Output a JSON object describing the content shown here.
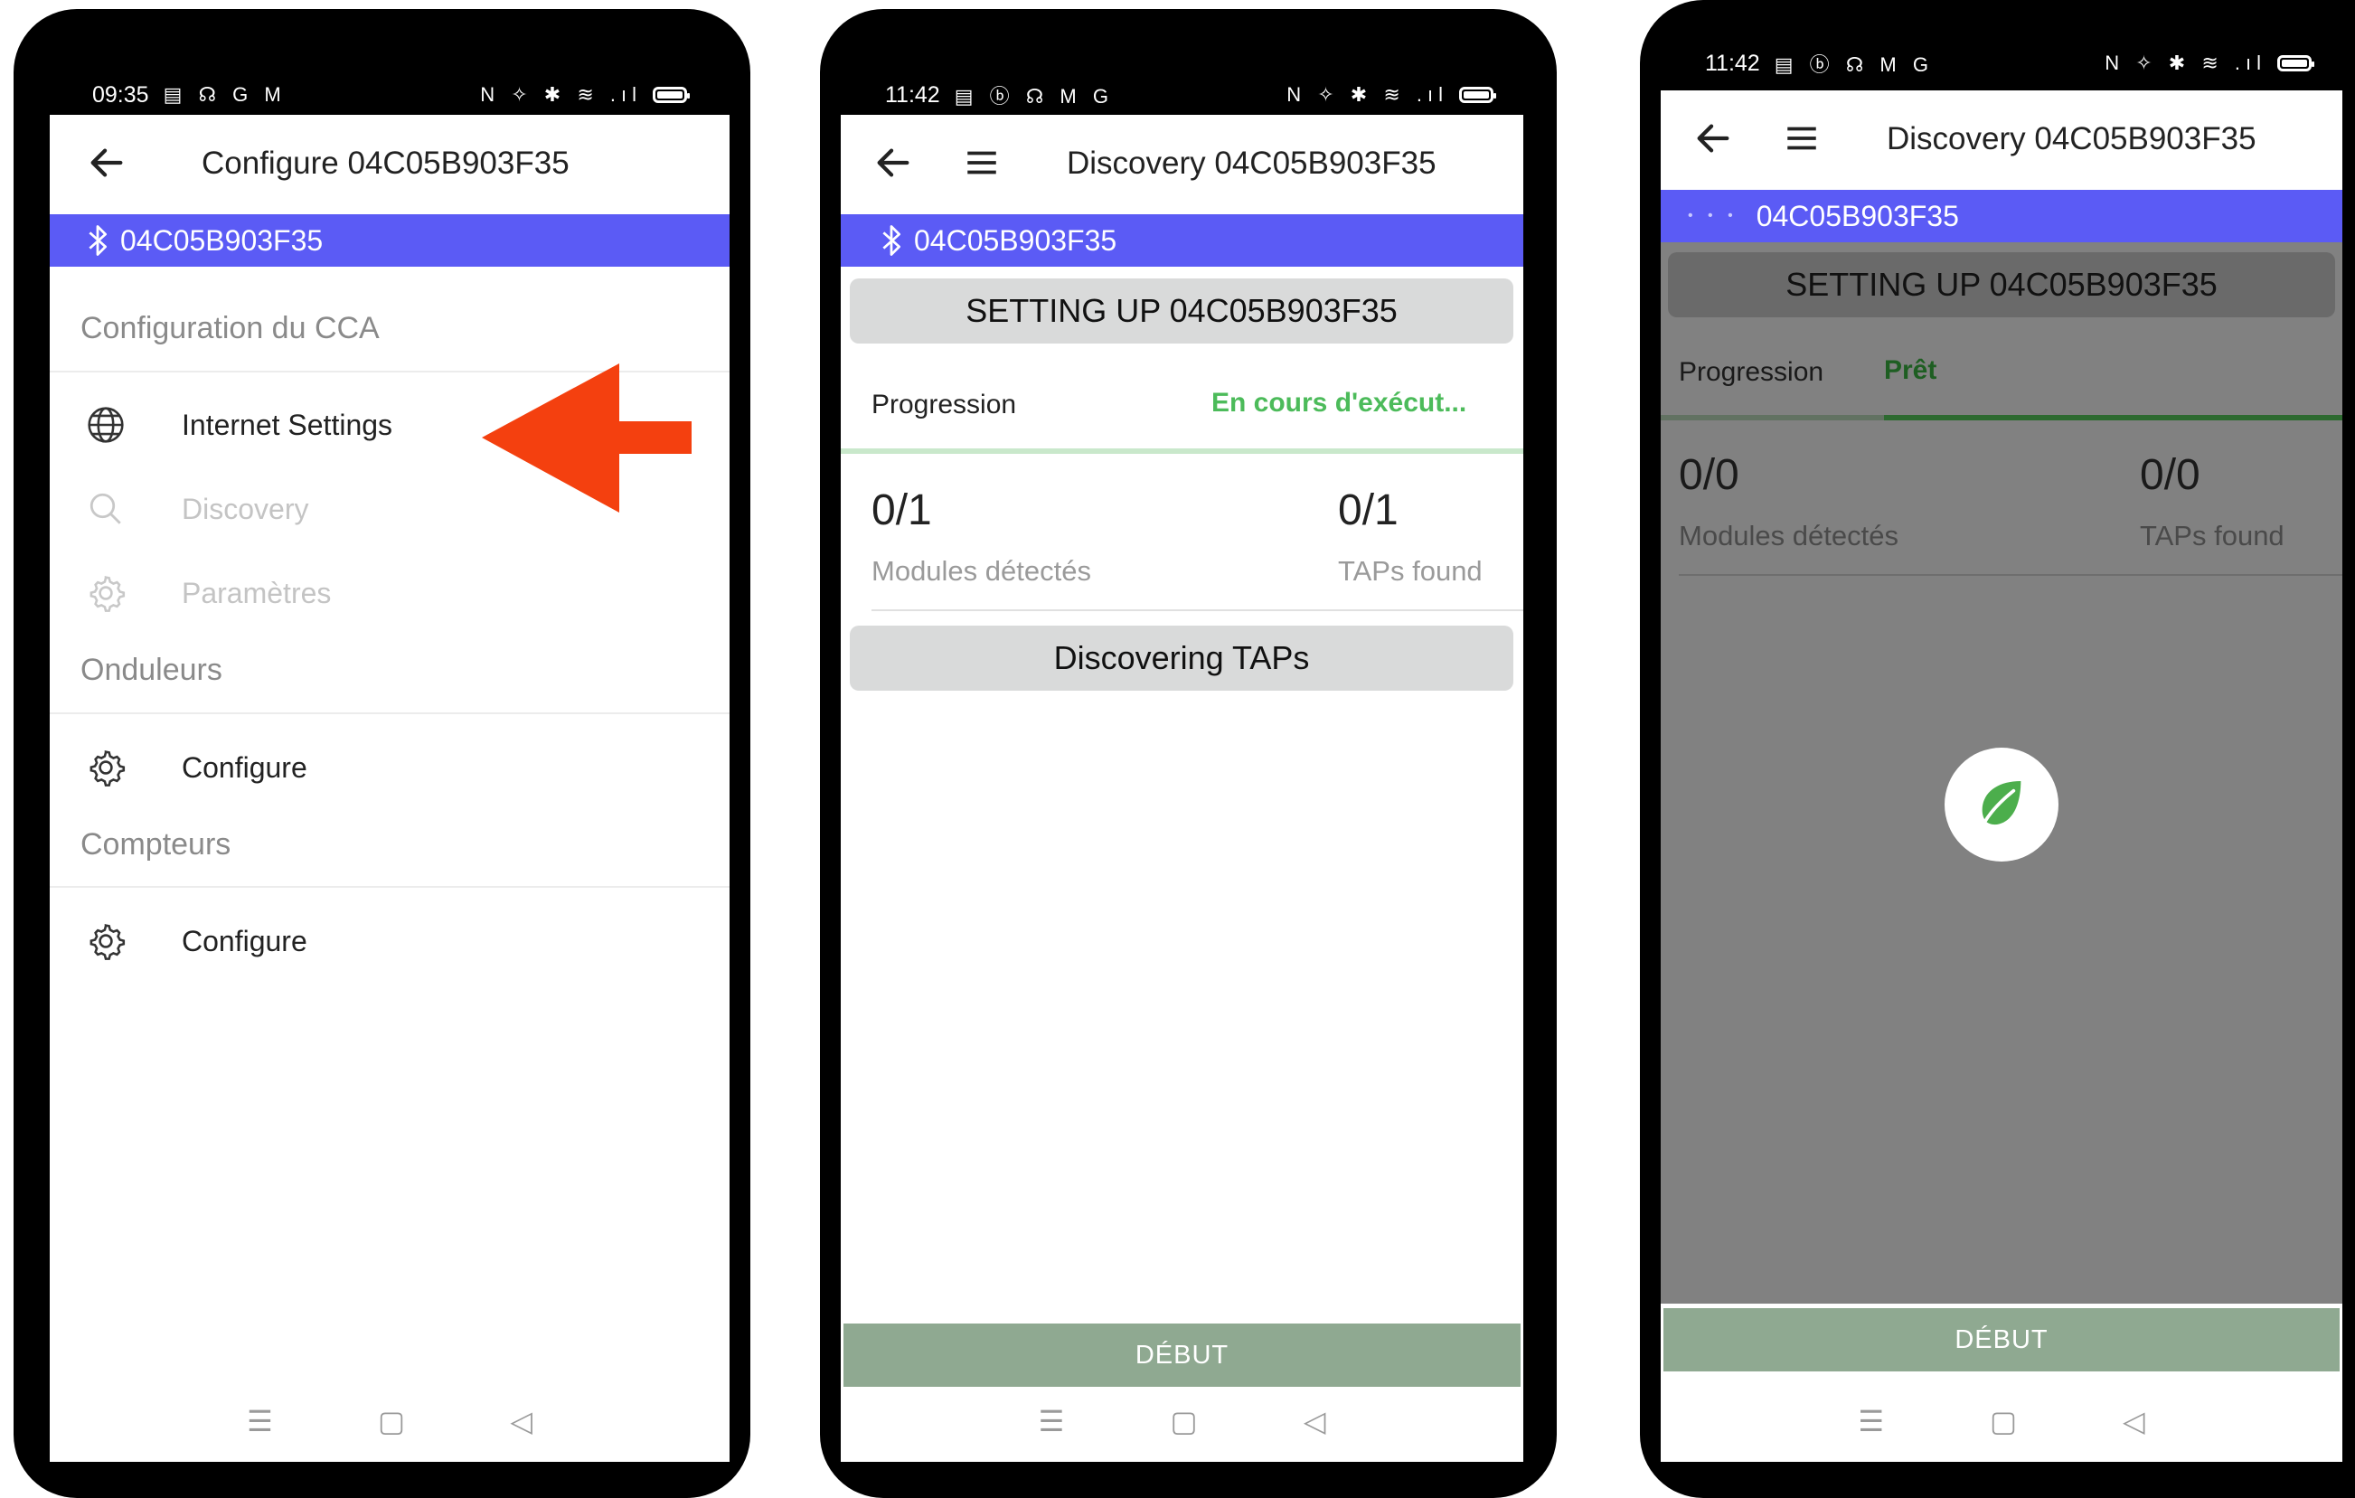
{
  "screens": [
    {
      "status_time": "09:35",
      "status_left_icons": "▤ ☊ G M",
      "status_right_icons": "N ✧ ✱ ≋ .ıl",
      "title": "Configure 04C05B903F35",
      "device": "04C05B903F35",
      "section_cca": "Configuration du CCA",
      "item_internet": "Internet Settings",
      "item_discovery": "Discovery",
      "item_parametres": "Paramètres",
      "section_onduleurs": "Onduleurs",
      "item_configure_onduleurs": "Configure",
      "section_compteurs": "Compteurs",
      "item_configure_compteurs": "Configure",
      "annotation_color": "#f4400f"
    },
    {
      "status_time": "11:42",
      "status_left_icons": "▤ ⓑ ☊ M G",
      "status_right_icons": "N ✧ ✱ ≋ .ıl",
      "title": "Discovery 04C05B903F35",
      "device": "04C05B903F35",
      "setup_label": "SETTING UP 04C05B903F35",
      "progress_label": "Progression",
      "progress_value": "En cours d'exécut...",
      "progress_color": "#4cbb5a",
      "modules_count": "0/1",
      "modules_label": "Modules détectés",
      "taps_count": "0/1",
      "taps_label": "TAPs found",
      "discovering_label": "Discovering TAPs",
      "debut_label": "DÉBUT"
    },
    {
      "status_time": "11:42",
      "status_left_icons": "▤ ⓑ ☊ M G",
      "status_right_icons": "N ✧ ✱ ≋ .ıl",
      "title": "Discovery 04C05B903F35",
      "device": "04C05B903F35",
      "setup_label": "SETTING UP 04C05B903F35",
      "progress_label": "Progression",
      "progress_value": "Prêt",
      "progress_color": "#1e5e22",
      "modules_count": "0/0",
      "modules_label": "Modules détectés",
      "taps_count": "0/0",
      "taps_label": "TAPs found",
      "debut_label": "DÉBUT",
      "leaf_color": "#4cae4c"
    }
  ]
}
